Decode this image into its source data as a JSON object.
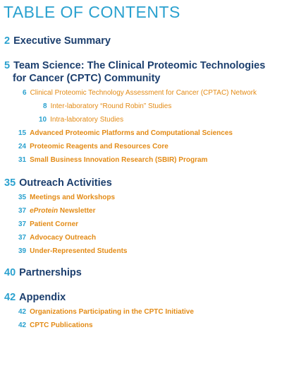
{
  "title": "TABLE OF CONTENTS",
  "sections": [
    {
      "page": "2",
      "label": "Executive Summary"
    },
    {
      "page": "5",
      "label_line1": "Team Science: The Clinical Proteomic Technologies",
      "label_line2": "for Cancer (CPTC) Community",
      "items": [
        {
          "page": "6",
          "label": "Clinical Proteomic Technology Assessment for Cancer (CPTAC) Network"
        },
        {
          "page": "8",
          "label": "Inter-laboratory “Round Robin” Studies"
        },
        {
          "page": "10",
          "label": "Intra-laboratory Studies"
        },
        {
          "page": "15",
          "label": "Advanced Proteomic Platforms and Computational Sciences"
        },
        {
          "page": "24",
          "label": "Proteomic Reagents and Resources Core"
        },
        {
          "page": "31",
          "label": "Small Business Innovation Research (SBIR) Program"
        }
      ]
    },
    {
      "page": "35",
      "label": "Outreach Activities",
      "items": [
        {
          "page": "35",
          "label": "Meetings and Workshops"
        },
        {
          "page": "37",
          "label_em": "eProtein",
          "label_rest": " Newsletter"
        },
        {
          "page": "37",
          "label": "Patient Corner"
        },
        {
          "page": "37",
          "label": "Advocacy Outreach"
        },
        {
          "page": "39",
          "label": "Under-Represented Students"
        }
      ]
    },
    {
      "page": "40",
      "label": "Partnerships"
    },
    {
      "page": "42",
      "label": "Appendix",
      "items": [
        {
          "page": "42",
          "label": "Organizations Participating in the CPTC Initiative"
        },
        {
          "page": "42",
          "label": "CPTC Publications"
        }
      ]
    }
  ],
  "colors": {
    "accent": "#2aa1cf",
    "heading": "#1c3f6e",
    "subitem": "#e38b16"
  }
}
